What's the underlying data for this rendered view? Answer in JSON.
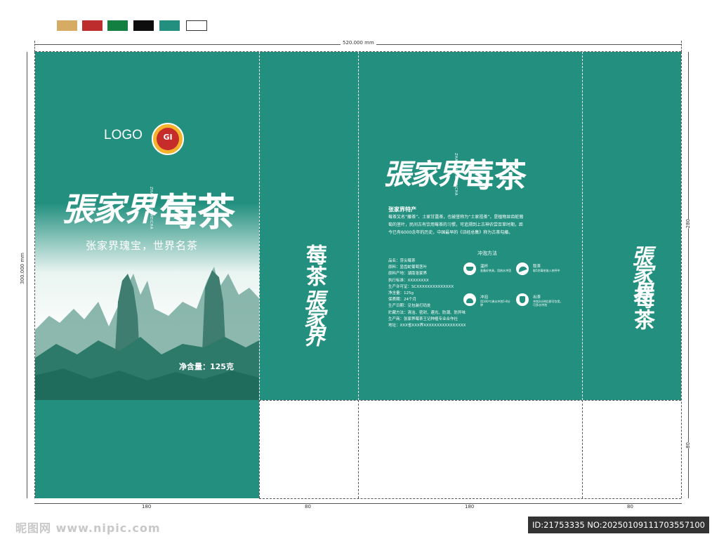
{
  "swatches": [
    "#d6ac64",
    "#bd2d2e",
    "#137f40",
    "#0d0d0d",
    "#23907f",
    "#ffffff"
  ],
  "dimensions": {
    "total_width": "520.000 mm",
    "total_height": "300.000 mm",
    "panel_front": "180",
    "panel_side": "80",
    "panel_back": "180",
    "panel_side2": "80",
    "right_top": "280",
    "right_bottom": "80"
  },
  "front": {
    "logo": "LOGO",
    "badge_text": "GI",
    "brand": "張家界",
    "brand_pinyin": "ZHANGJIAJIE MEICHA",
    "product": "莓茶",
    "slogan": "张家界瑰宝，世界名茶",
    "net_weight": "净含量：125克"
  },
  "side": {
    "brand": "張家界",
    "product": "莓茶"
  },
  "back": {
    "brand": "張家界",
    "brand_pinyin": "ZHANGJIAJIE MEICHA",
    "product": "莓茶",
    "intro_title": "张家界特产",
    "intro_lines": [
      "莓茶又名“藤茶”、土家甘露茶，也被誉称为“土家祖茶”，是植物显齿蛇葡",
      "萄的茎叶，民间古有饮用莓茶的习惯，可追溯到上古神农尝百草时期，距",
      "今已有6000余年的历史，中国最早的《诗经总集》称为古茶勾藤。"
    ],
    "specs": [
      "品名：芽尖莓茶",
      "原料：显齿蛇葡萄茎叶",
      "原料产地：湖南张家界",
      "执行标准：XXXXXXXX",
      "生产许可证：SCXXXXXXXXXXXXXX",
      "净含量：125g",
      "保质期：24个月",
      "生产日期：见包装打码处",
      "贮藏方法：清洁、密封、避光、防潮、防异味",
      "生产商：张家界莓茶王记种植专业合作社",
      "地址：XXX省XXX界XXXXXXXXXXXXXXXX"
    ],
    "brew_title": "冲泡方法",
    "brew_steps": [
      {
        "title": "温杯",
        "desc": "准备好茶具，用热水冲烫",
        "icon": "cup-icon"
      },
      {
        "title": "取茶",
        "desc": "取5克莓茶放入茶杯中",
        "icon": "scoop-icon"
      },
      {
        "title": "冲泡",
        "desc": "用100℃沸水冲泡5-8分钟",
        "icon": "pot-icon"
      },
      {
        "title": "出茶",
        "desc": "冲泡3分钟后即可饮用，可多次冲泡",
        "icon": "pour-icon"
      }
    ]
  },
  "side2": {
    "brand": "張家界",
    "product": "莓茶"
  },
  "watermark": {
    "left": "昵图网 www.nipic.com",
    "right": "ID:21753335 NO:20250109111703557100"
  }
}
